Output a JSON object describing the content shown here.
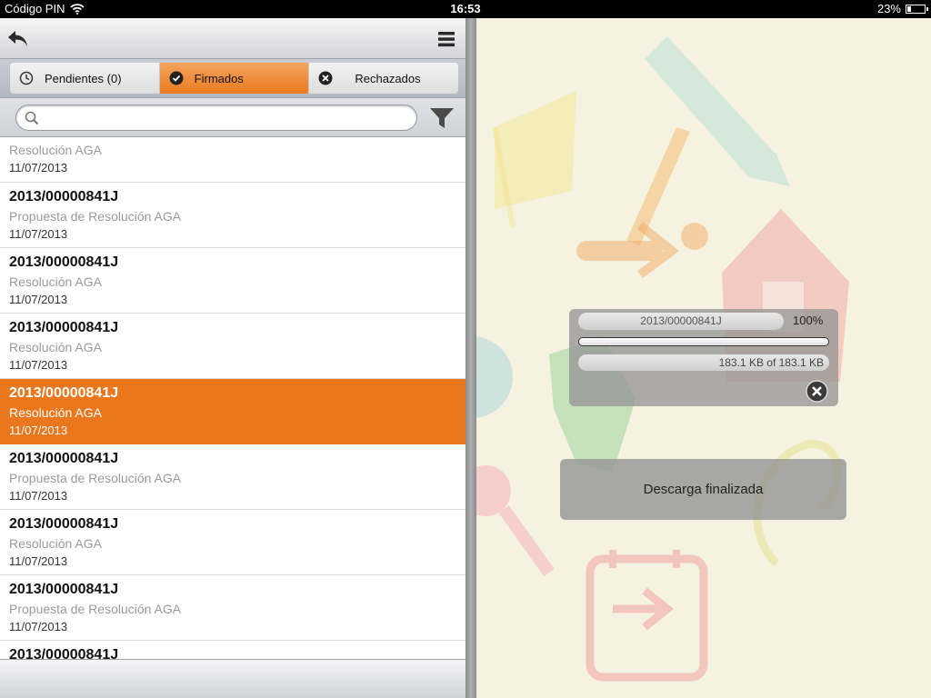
{
  "status_bar": {
    "carrier": "Código PIN",
    "time": "16:53",
    "battery": "23%",
    "battery_level": 0.23,
    "wifi_icon": "wifi-icon"
  },
  "toolbar": {
    "back_icon": "back-arrow-icon",
    "menu_icon": "hamburger-menu-icon"
  },
  "tabs": [
    {
      "label": "Pendientes (0)",
      "icon": "clock-icon",
      "active": false
    },
    {
      "label": "Firmados",
      "icon": "check-circle-icon",
      "active": true
    },
    {
      "label": "Rechazados",
      "icon": "x-circle-icon",
      "active": false
    }
  ],
  "search": {
    "value": "",
    "placeholder": "",
    "filter_icon": "filter-icon"
  },
  "documents": [
    {
      "title": "",
      "subtitle": "Resolución AGA",
      "date": "11/07/2013",
      "partial": true
    },
    {
      "title": "2013/00000841J",
      "subtitle": "Propuesta de Resolución AGA",
      "date": "11/07/2013"
    },
    {
      "title": "2013/00000841J",
      "subtitle": "Resolución AGA",
      "date": "11/07/2013"
    },
    {
      "title": "2013/00000841J",
      "subtitle": "Resolución AGA",
      "date": "11/07/2013"
    },
    {
      "title": "2013/00000841J",
      "subtitle": "Resolución AGA",
      "date": "11/07/2013",
      "selected": true
    },
    {
      "title": "2013/00000841J",
      "subtitle": "Propuesta de Resolución AGA",
      "date": "11/07/2013"
    },
    {
      "title": "2013/00000841J",
      "subtitle": "Resolución AGA",
      "date": "11/07/2013"
    },
    {
      "title": "2013/00000841J",
      "subtitle": "Propuesta de Resolución AGA",
      "date": "11/07/2013"
    },
    {
      "title": "2013/00000841J",
      "subtitle": "",
      "date": ""
    }
  ],
  "download": {
    "file_name": "2013/00000841J",
    "percent_label": "100%",
    "progress": 1.0,
    "size_label": "183.1 KB of 183.1 KB",
    "close_icon": "close-circle-icon"
  },
  "toast": {
    "message": "Descarga finalizada"
  },
  "colors": {
    "accent": "#eb771c",
    "right_background": "#f5f2e1"
  }
}
